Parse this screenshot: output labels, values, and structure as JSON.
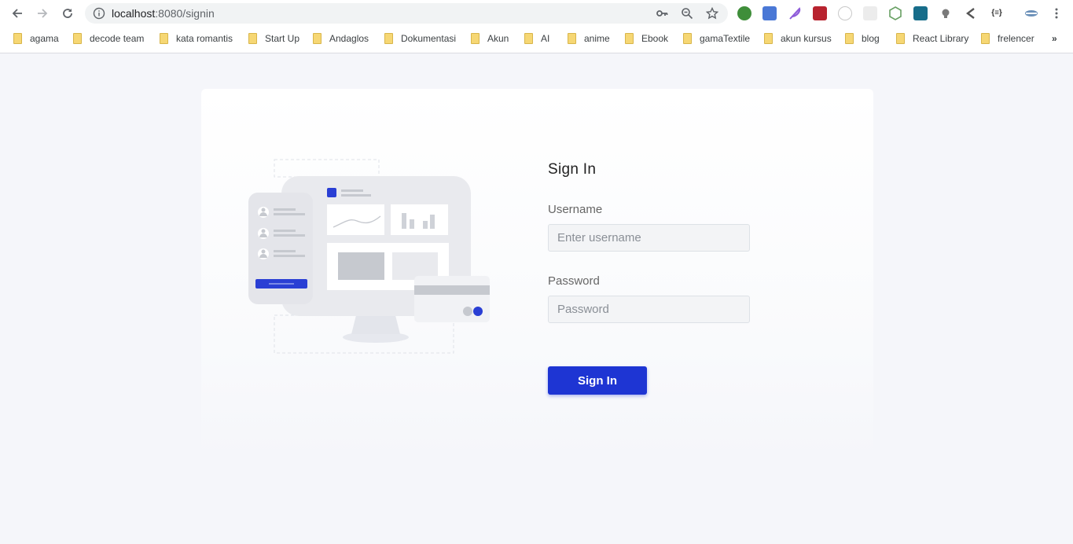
{
  "browser": {
    "url_host": "localhost",
    "url_rest": ":8080/signin",
    "bookmarks": [
      {
        "label": "agama"
      },
      {
        "label": "decode team"
      },
      {
        "label": "kata romantis"
      },
      {
        "label": "Start Up"
      },
      {
        "label": "Andaglos"
      },
      {
        "label": "Dokumentasi"
      },
      {
        "label": "Akun"
      },
      {
        "label": "AI"
      },
      {
        "label": "anime"
      },
      {
        "label": "Ebook"
      },
      {
        "label": "gamaTextile"
      },
      {
        "label": "akun kursus"
      },
      {
        "label": "blog"
      },
      {
        "label": "React Library"
      },
      {
        "label": "frelencer"
      }
    ],
    "overflow_label": "»",
    "extension_colors": [
      "#3f8e3a",
      "#4a78d6",
      "#8e5cd9",
      "#b8232f",
      "#c9c9c9",
      "#e0e0e0",
      "#68a063",
      "#176d8a",
      "#7a7a7a",
      "#555555",
      "#333333",
      "#6a8fb8"
    ]
  },
  "signin": {
    "title": "Sign In",
    "username_label": "Username",
    "username_placeholder": "Enter username",
    "password_label": "Password",
    "password_placeholder": "Password",
    "submit_label": "Sign In"
  },
  "colors": {
    "accent": "#1e35d3",
    "background": "#f5f6fa"
  }
}
